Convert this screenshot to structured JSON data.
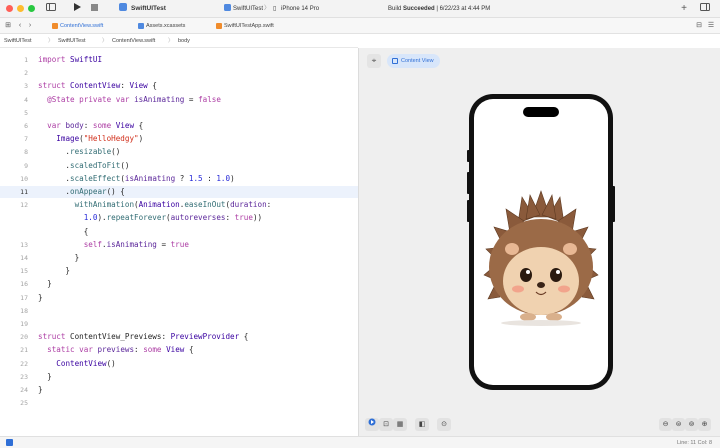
{
  "window": {
    "project_name": "SwiftUITest",
    "scheme": "SwiftUITest",
    "device": "iPhone 14 Pro",
    "build_status_prefix": "Build ",
    "build_status_result": "Succeeded",
    "build_status_time": " | 6/22/23 at 4:44 PM",
    "plus": "+",
    "run_icon": "play-icon"
  },
  "tabs": [
    {
      "label": "ContentView.swift",
      "active": true
    },
    {
      "label": "Assets.xcassets",
      "active": false
    },
    {
      "label": "SwiftUITestApp.swift",
      "active": false
    }
  ],
  "breadcrumbs": [
    "SwiftUITest",
    "SwiftUITest",
    "ContentView.swift",
    "body"
  ],
  "editor": {
    "current_line": 11,
    "lines": [
      {
        "n": "1",
        "t": "import SwiftUI"
      },
      {
        "n": "2",
        "t": ""
      },
      {
        "n": "3",
        "t": "struct ContentView: View {"
      },
      {
        "n": "4",
        "t": "  @State private var isAnimating = false"
      },
      {
        "n": "5",
        "t": ""
      },
      {
        "n": "6",
        "t": "  var body: some View {"
      },
      {
        "n": "7",
        "t": "    Image(\"HelloHedgy\")"
      },
      {
        "n": "8",
        "t": "      .resizable()"
      },
      {
        "n": "9",
        "t": "      .scaledToFit()"
      },
      {
        "n": "10",
        "t": "      .scaleEffect(isAnimating ? 1.5 : 1.0)"
      },
      {
        "n": "11",
        "t": "      .onAppear() {"
      },
      {
        "n": "12",
        "t": "        withAnimation(Animation.easeInOut(duration:"
      },
      {
        "n": "",
        "t": "          1.0).repeatForever(autoreverses: true))"
      },
      {
        "n": "",
        "t": "          {"
      },
      {
        "n": "13",
        "t": "          self.isAnimating = true"
      },
      {
        "n": "14",
        "t": "        }"
      },
      {
        "n": "15",
        "t": "      }"
      },
      {
        "n": "16",
        "t": "  }"
      },
      {
        "n": "17",
        "t": "}"
      },
      {
        "n": "18",
        "t": ""
      },
      {
        "n": "19",
        "t": ""
      },
      {
        "n": "20",
        "t": "struct ContentView_Previews: PreviewProvider {"
      },
      {
        "n": "21",
        "t": "  static var previews: some View {"
      },
      {
        "n": "22",
        "t": "    ContentView()"
      },
      {
        "n": "23",
        "t": "  }"
      },
      {
        "n": "24",
        "t": "}"
      },
      {
        "n": "25",
        "t": ""
      }
    ]
  },
  "canvas": {
    "preview_label": "Content View",
    "pin_icon": "pin-icon",
    "zoom_icons": [
      "zoom-out-icon",
      "zoom-actual-icon",
      "zoom-fit-icon",
      "zoom-in-icon"
    ]
  },
  "status": {
    "position": "Line: 11  Col: 8"
  },
  "colors": {
    "accent": "#2f6fd6",
    "keyword": "#ad3da4",
    "string": "#d12f1b",
    "number": "#272ad8"
  }
}
